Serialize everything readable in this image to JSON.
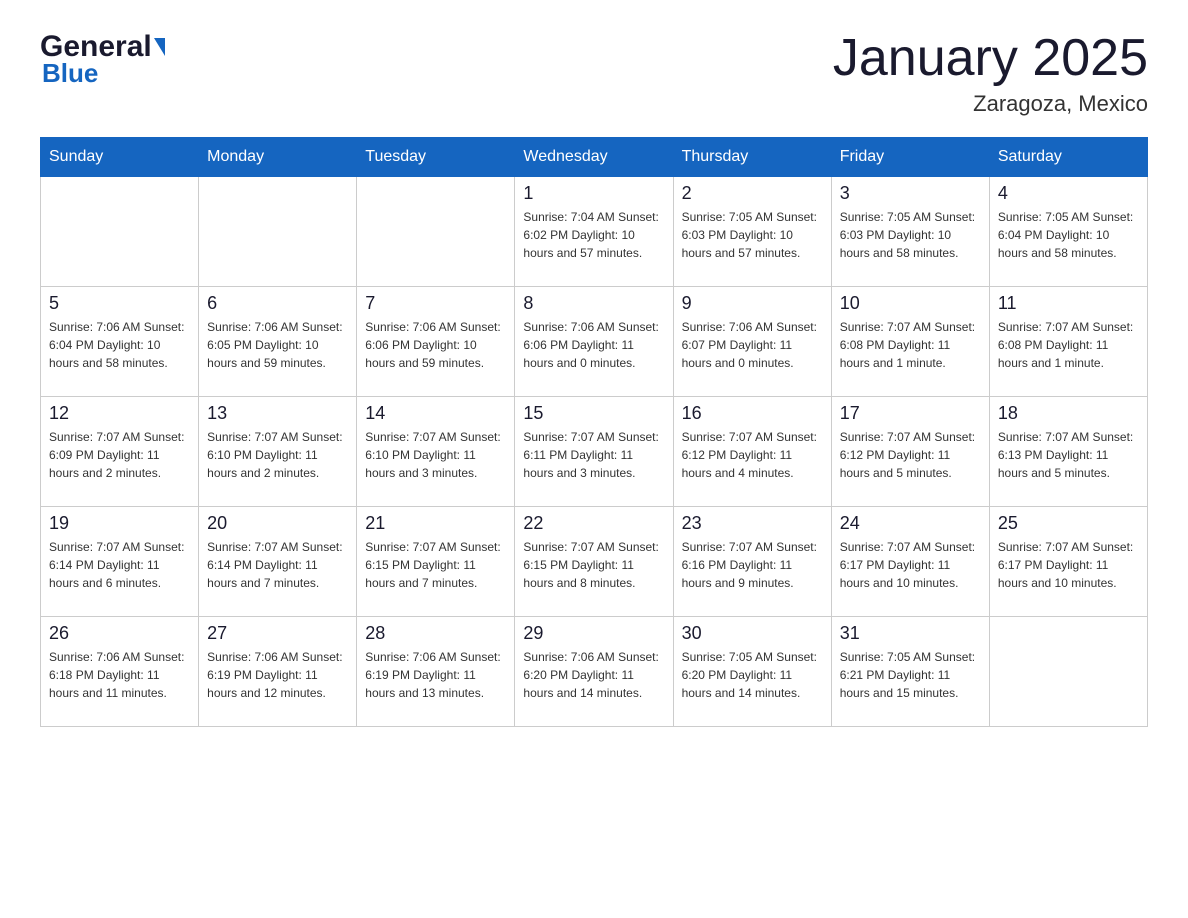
{
  "header": {
    "logo_text1": "General",
    "logo_text2": "Blue",
    "title": "January 2025",
    "subtitle": "Zaragoza, Mexico"
  },
  "calendar": {
    "days_of_week": [
      "Sunday",
      "Monday",
      "Tuesday",
      "Wednesday",
      "Thursday",
      "Friday",
      "Saturday"
    ],
    "weeks": [
      [
        {
          "day": "",
          "info": ""
        },
        {
          "day": "",
          "info": ""
        },
        {
          "day": "",
          "info": ""
        },
        {
          "day": "1",
          "info": "Sunrise: 7:04 AM\nSunset: 6:02 PM\nDaylight: 10 hours\nand 57 minutes."
        },
        {
          "day": "2",
          "info": "Sunrise: 7:05 AM\nSunset: 6:03 PM\nDaylight: 10 hours\nand 57 minutes."
        },
        {
          "day": "3",
          "info": "Sunrise: 7:05 AM\nSunset: 6:03 PM\nDaylight: 10 hours\nand 58 minutes."
        },
        {
          "day": "4",
          "info": "Sunrise: 7:05 AM\nSunset: 6:04 PM\nDaylight: 10 hours\nand 58 minutes."
        }
      ],
      [
        {
          "day": "5",
          "info": "Sunrise: 7:06 AM\nSunset: 6:04 PM\nDaylight: 10 hours\nand 58 minutes."
        },
        {
          "day": "6",
          "info": "Sunrise: 7:06 AM\nSunset: 6:05 PM\nDaylight: 10 hours\nand 59 minutes."
        },
        {
          "day": "7",
          "info": "Sunrise: 7:06 AM\nSunset: 6:06 PM\nDaylight: 10 hours\nand 59 minutes."
        },
        {
          "day": "8",
          "info": "Sunrise: 7:06 AM\nSunset: 6:06 PM\nDaylight: 11 hours\nand 0 minutes."
        },
        {
          "day": "9",
          "info": "Sunrise: 7:06 AM\nSunset: 6:07 PM\nDaylight: 11 hours\nand 0 minutes."
        },
        {
          "day": "10",
          "info": "Sunrise: 7:07 AM\nSunset: 6:08 PM\nDaylight: 11 hours\nand 1 minute."
        },
        {
          "day": "11",
          "info": "Sunrise: 7:07 AM\nSunset: 6:08 PM\nDaylight: 11 hours\nand 1 minute."
        }
      ],
      [
        {
          "day": "12",
          "info": "Sunrise: 7:07 AM\nSunset: 6:09 PM\nDaylight: 11 hours\nand 2 minutes."
        },
        {
          "day": "13",
          "info": "Sunrise: 7:07 AM\nSunset: 6:10 PM\nDaylight: 11 hours\nand 2 minutes."
        },
        {
          "day": "14",
          "info": "Sunrise: 7:07 AM\nSunset: 6:10 PM\nDaylight: 11 hours\nand 3 minutes."
        },
        {
          "day": "15",
          "info": "Sunrise: 7:07 AM\nSunset: 6:11 PM\nDaylight: 11 hours\nand 3 minutes."
        },
        {
          "day": "16",
          "info": "Sunrise: 7:07 AM\nSunset: 6:12 PM\nDaylight: 11 hours\nand 4 minutes."
        },
        {
          "day": "17",
          "info": "Sunrise: 7:07 AM\nSunset: 6:12 PM\nDaylight: 11 hours\nand 5 minutes."
        },
        {
          "day": "18",
          "info": "Sunrise: 7:07 AM\nSunset: 6:13 PM\nDaylight: 11 hours\nand 5 minutes."
        }
      ],
      [
        {
          "day": "19",
          "info": "Sunrise: 7:07 AM\nSunset: 6:14 PM\nDaylight: 11 hours\nand 6 minutes."
        },
        {
          "day": "20",
          "info": "Sunrise: 7:07 AM\nSunset: 6:14 PM\nDaylight: 11 hours\nand 7 minutes."
        },
        {
          "day": "21",
          "info": "Sunrise: 7:07 AM\nSunset: 6:15 PM\nDaylight: 11 hours\nand 7 minutes."
        },
        {
          "day": "22",
          "info": "Sunrise: 7:07 AM\nSunset: 6:15 PM\nDaylight: 11 hours\nand 8 minutes."
        },
        {
          "day": "23",
          "info": "Sunrise: 7:07 AM\nSunset: 6:16 PM\nDaylight: 11 hours\nand 9 minutes."
        },
        {
          "day": "24",
          "info": "Sunrise: 7:07 AM\nSunset: 6:17 PM\nDaylight: 11 hours\nand 10 minutes."
        },
        {
          "day": "25",
          "info": "Sunrise: 7:07 AM\nSunset: 6:17 PM\nDaylight: 11 hours\nand 10 minutes."
        }
      ],
      [
        {
          "day": "26",
          "info": "Sunrise: 7:06 AM\nSunset: 6:18 PM\nDaylight: 11 hours\nand 11 minutes."
        },
        {
          "day": "27",
          "info": "Sunrise: 7:06 AM\nSunset: 6:19 PM\nDaylight: 11 hours\nand 12 minutes."
        },
        {
          "day": "28",
          "info": "Sunrise: 7:06 AM\nSunset: 6:19 PM\nDaylight: 11 hours\nand 13 minutes."
        },
        {
          "day": "29",
          "info": "Sunrise: 7:06 AM\nSunset: 6:20 PM\nDaylight: 11 hours\nand 14 minutes."
        },
        {
          "day": "30",
          "info": "Sunrise: 7:05 AM\nSunset: 6:20 PM\nDaylight: 11 hours\nand 14 minutes."
        },
        {
          "day": "31",
          "info": "Sunrise: 7:05 AM\nSunset: 6:21 PM\nDaylight: 11 hours\nand 15 minutes."
        },
        {
          "day": "",
          "info": ""
        }
      ]
    ]
  }
}
